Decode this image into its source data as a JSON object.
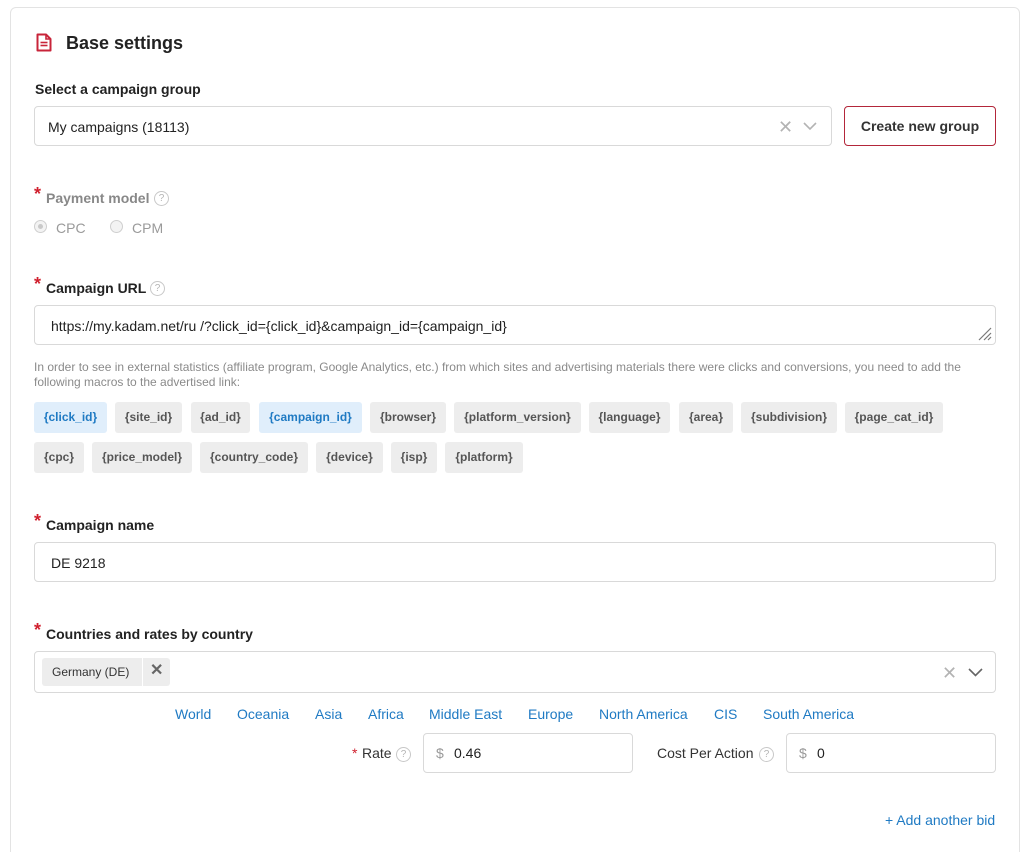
{
  "section": {
    "title": "Base settings",
    "icon": "document-icon"
  },
  "campaign_group": {
    "label": "Select a campaign group",
    "selected": "My campaigns (18113)",
    "create_button": "Create new group"
  },
  "payment_model": {
    "required_mark": "*",
    "label": "Payment model",
    "help": "?",
    "options": [
      {
        "label": "CPC",
        "checked": true
      },
      {
        "label": "CPM",
        "checked": false
      }
    ]
  },
  "campaign_url": {
    "required_mark": "*",
    "label": "Campaign URL",
    "help": "?",
    "value": "https://my.kadam.net/ru /?click_id={click_id}&campaign_id={campaign_id}",
    "hint": "In order to see in external statistics (affiliate program, Google Analytics, etc.) from which sites and advertising materials there were clicks and conversions, you need to add the following macros to the advertised link:",
    "macros": [
      {
        "label": "{click_id}",
        "active": true
      },
      {
        "label": "{site_id}",
        "active": false
      },
      {
        "label": "{ad_id}",
        "active": false
      },
      {
        "label": "{campaign_id}",
        "active": true
      },
      {
        "label": "{browser}",
        "active": false
      },
      {
        "label": "{platform_version}",
        "active": false
      },
      {
        "label": "{language}",
        "active": false
      },
      {
        "label": "{area}",
        "active": false
      },
      {
        "label": "{subdivision}",
        "active": false
      },
      {
        "label": "{page_cat_id}",
        "active": false
      },
      {
        "label": "{cpc}",
        "active": false
      },
      {
        "label": "{price_model}",
        "active": false
      },
      {
        "label": "{country_code}",
        "active": false
      },
      {
        "label": "{device}",
        "active": false
      },
      {
        "label": "{isp}",
        "active": false
      },
      {
        "label": "{platform}",
        "active": false
      }
    ]
  },
  "campaign_name": {
    "required_mark": "*",
    "label": "Campaign name",
    "value": "DE 9218"
  },
  "countries": {
    "required_mark": "*",
    "label": "Countries and rates by country",
    "selected_tags": [
      "Germany (DE)"
    ],
    "regions": [
      "World",
      "Oceania",
      "Asia",
      "Africa",
      "Middle East",
      "Europe",
      "North America",
      "CIS",
      "South America"
    ],
    "rate_required_mark": "*",
    "rate_label": "Rate",
    "rate_help": "?",
    "rate_currency": "$",
    "rate_value": "0.46",
    "cpa_label": "Cost Per Action",
    "cpa_help": "?",
    "cpa_currency": "$",
    "cpa_value": "0",
    "add_bid": "+ Add another bid"
  },
  "colors": {
    "accent_red": "#b3263a",
    "required_red": "#d0202e",
    "link_blue": "#1f7ac3",
    "macro_active_bg": "#e0eefb",
    "macro_bg": "#ededed"
  }
}
